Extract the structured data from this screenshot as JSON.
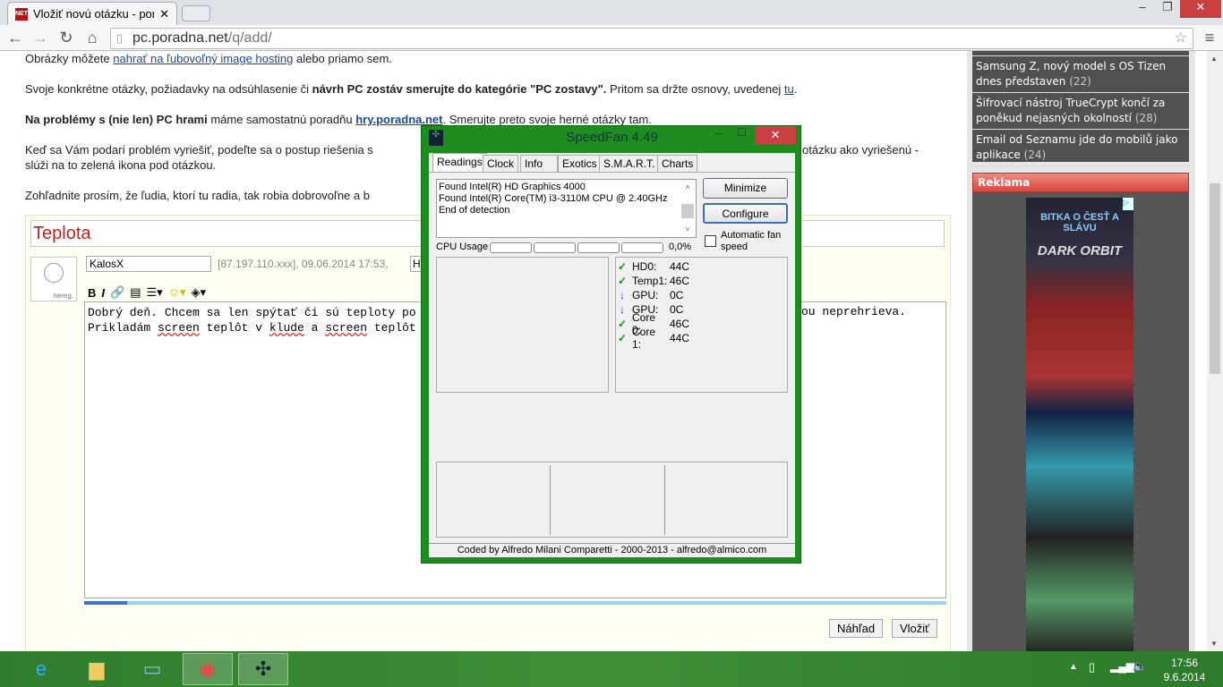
{
  "browser": {
    "tab_title": "Vložiť novú otázku - porac",
    "favicon_text": "NET",
    "url_host": "pc.poradna.net",
    "url_path": "/q/add/"
  },
  "content": {
    "line1_a": "Obrázky môžete ",
    "line1_link": "nahrať na ľubovoľný image hosting",
    "line1_b": " alebo priamo sem.",
    "line2_a": "Svoje konkrétne otázky, požiadavky na odsúhlasenie či ",
    "line2_bold": "návrh PC zostáv smerujte do kategórie \"PC zostavy\".",
    "line2_b": " Pritom sa držte osnovy, uvedenej ",
    "line2_link": "tu",
    "line2_c": ".",
    "line3_bold": "Na problémy s (nie len) PC hrami",
    "line3_a": " máme samostatnú poradňu ",
    "line3_link": "hry.poradna.net",
    "line3_b": ". Smerujte preto svoje herné otázky tam.",
    "line4_a": "Keď sa Vám podarí problém vyriešiť, podeľte sa o postup riešenia s",
    "line4_b": "otázku ako vyriešenú -",
    "line4_c": "slúži na to zelená ikona pod otázkou.",
    "line5": "Zohľadnite prosím, že ľudia, ktorí tu radia, tak robia dobrovoľne a b"
  },
  "form": {
    "title": "Teplota",
    "avatar_label": "nereg.",
    "name": "KalosX",
    "meta": "[87.197.110.xxx], 09.06.2014 17:53,",
    "hidden_field": "H",
    "body_line1_a": "Dobrý deň. Chcem sa len spýtať či sú teploty po",
    "body_line1_b": "ou neprehrieva.",
    "body_line2": [
      "Prikladám ",
      "screen",
      " teplôt v ",
      "klude",
      " a ",
      "screen",
      " teplôt"
    ],
    "progress": 0.05,
    "preview_label": "Náhľad",
    "submit_label": "Vložiť"
  },
  "sidebar": {
    "news": [
      {
        "title": "Samsung Z, nový model s OS Tizen dnes představen",
        "count": "22"
      },
      {
        "title": "Šifrovací nástroj TrueCrypt končí za poněkud nejasných okolností",
        "count": "28"
      },
      {
        "title": "Email od Seznamu jde do mobilů jako aplikace",
        "count": "24"
      }
    ],
    "ad_header": "Reklama",
    "ad_text": "BITKA O ČESŤ A SLÁVU",
    "ad_brand": "DARK ORBIT"
  },
  "speedfan": {
    "title": "SpeedFan 4.49",
    "tabs": [
      "Readings",
      "Clock",
      "Info",
      "Exotics",
      "S.M.A.R.T.",
      "Charts"
    ],
    "log": [
      "Found Intel(R) HD Graphics 4000",
      "Found Intel(R) Core(TM) i3-3110M CPU @ 2.40GHz",
      "End of detection"
    ],
    "minimize": "Minimize",
    "configure": "Configure",
    "auto_fan": "Automatic fan speed",
    "cpu_label": "CPU Usage",
    "cpu_value": "0,0%",
    "readings": [
      {
        "icon": "check",
        "label": "HD0:",
        "value": "44C"
      },
      {
        "icon": "down",
        "label": "Temp1:",
        "value": "46C"
      },
      {
        "icon": "arrow",
        "label": "GPU:",
        "value": "0C"
      },
      {
        "icon": "arrow",
        "label": "GPU:",
        "value": "0C"
      },
      {
        "icon": "check",
        "label": "Core 0:",
        "value": "46C"
      },
      {
        "icon": "check",
        "label": "Core 1:",
        "value": "44C"
      }
    ],
    "footer": "Coded by Alfredo Milani Comparetti - 2000-2013 - alfredo@almico.com"
  },
  "taskbar": {
    "time": "17:56",
    "date": "9.6.2014"
  }
}
